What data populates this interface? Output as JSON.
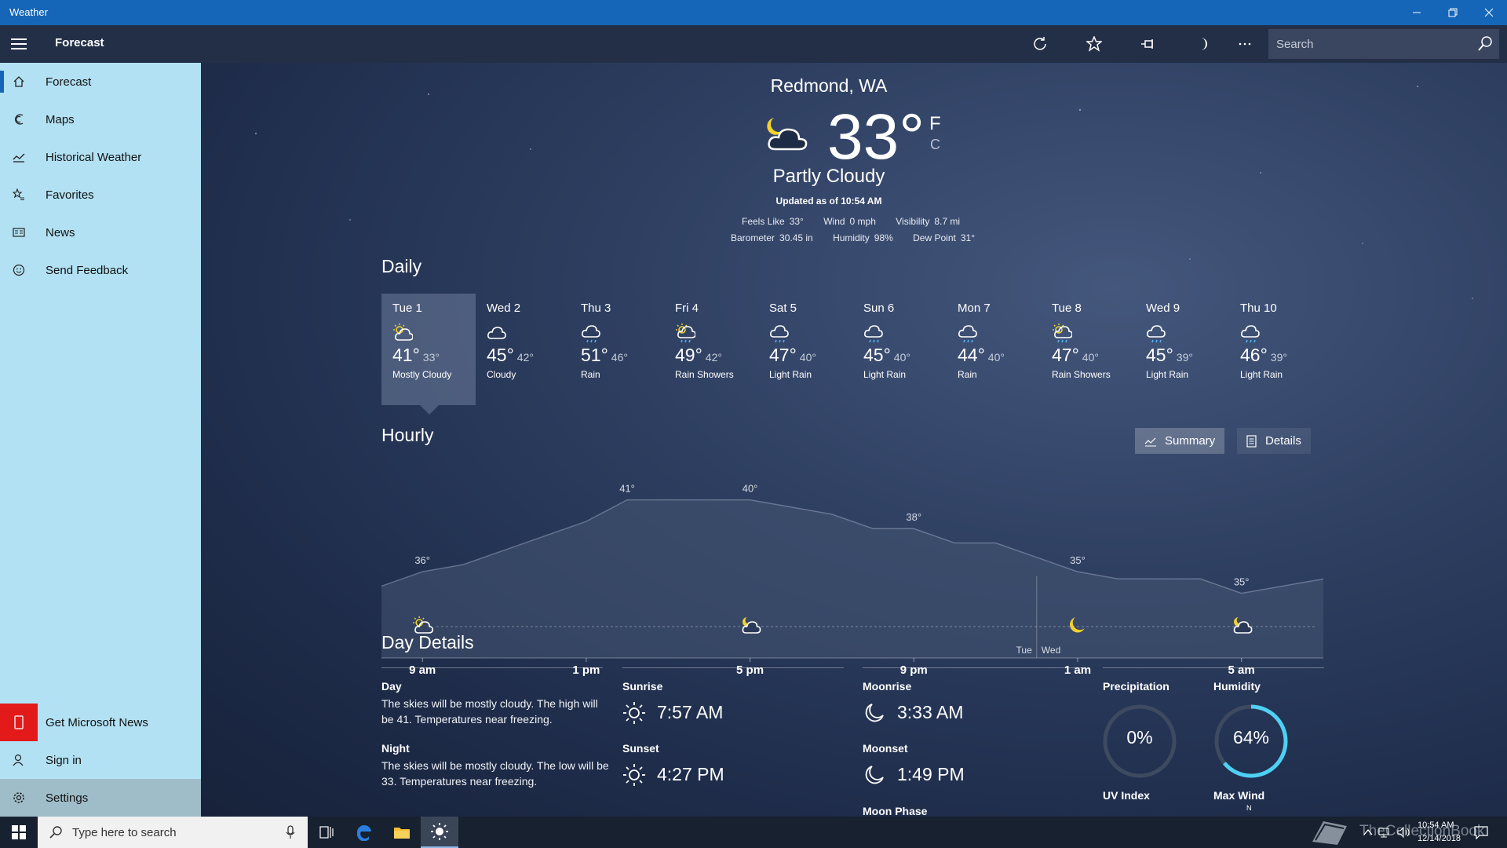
{
  "window": {
    "title": "Weather"
  },
  "header": {
    "title": "Forecast",
    "search_placeholder": "Search"
  },
  "nav": {
    "items": [
      {
        "label": "Forecast",
        "icon": "home-icon"
      },
      {
        "label": "Maps",
        "icon": "map-icon"
      },
      {
        "label": "Historical Weather",
        "icon": "chart-icon"
      },
      {
        "label": "Favorites",
        "icon": "favorites-icon"
      },
      {
        "label": "News",
        "icon": "news-icon"
      },
      {
        "label": "Send Feedback",
        "icon": "smiley-icon"
      }
    ],
    "bottom": [
      {
        "label": "Get Microsoft News",
        "icon": "phone-icon"
      },
      {
        "label": "Sign in",
        "icon": "person-icon"
      },
      {
        "label": "Settings",
        "icon": "gear-icon"
      }
    ]
  },
  "current": {
    "location": "Redmond, WA",
    "temp": "33°",
    "unit_f": "F",
    "unit_c": "C",
    "condition": "Partly Cloudy",
    "updated": "Updated as of 10:54 AM",
    "feels_like_label": "Feels Like",
    "feels_like": "33°",
    "wind_label": "Wind",
    "wind": "0 mph",
    "visibility_label": "Visibility",
    "visibility": "8.7 mi",
    "barometer_label": "Barometer",
    "barometer": "30.45 in",
    "humidity_label": "Humidity",
    "humidity": "98%",
    "dew_point_label": "Dew Point",
    "dew_point": "31°"
  },
  "daily": {
    "title": "Daily",
    "days": [
      {
        "name": "Tue 1",
        "hi": "41°",
        "lo": "33°",
        "cond": "Mostly Cloudy",
        "icon": "mostly-cloudy"
      },
      {
        "name": "Wed 2",
        "hi": "45°",
        "lo": "42°",
        "cond": "Cloudy",
        "icon": "cloudy"
      },
      {
        "name": "Thu 3",
        "hi": "51°",
        "lo": "46°",
        "cond": "Rain",
        "icon": "rain"
      },
      {
        "name": "Fri 4",
        "hi": "49°",
        "lo": "42°",
        "cond": "Rain Showers",
        "icon": "rain-showers"
      },
      {
        "name": "Sat 5",
        "hi": "47°",
        "lo": "40°",
        "cond": "Light Rain",
        "icon": "rain"
      },
      {
        "name": "Sun 6",
        "hi": "45°",
        "lo": "40°",
        "cond": "Light Rain",
        "icon": "rain"
      },
      {
        "name": "Mon 7",
        "hi": "44°",
        "lo": "40°",
        "cond": "Rain",
        "icon": "rain"
      },
      {
        "name": "Tue 8",
        "hi": "47°",
        "lo": "40°",
        "cond": "Rain Showers",
        "icon": "rain-showers"
      },
      {
        "name": "Wed 9",
        "hi": "45°",
        "lo": "39°",
        "cond": "Light Rain",
        "icon": "rain"
      },
      {
        "name": "Thu 10",
        "hi": "46°",
        "lo": "39°",
        "cond": "Light Rain",
        "icon": "rain"
      }
    ]
  },
  "hourly": {
    "title": "Hourly",
    "summary_label": "Summary",
    "details_label": "Details",
    "day_divider": {
      "before": "Tue",
      "after": "Wed"
    },
    "time_labels": [
      "9 am",
      "1 pm",
      "5 pm",
      "9 pm",
      "1 am",
      "5 am"
    ],
    "temp_labels": [
      {
        "hour": 9,
        "text": "36°"
      },
      {
        "hour": 14,
        "text": "41°"
      },
      {
        "hour": 17,
        "text": "40°"
      },
      {
        "hour": 21,
        "text": "38°"
      },
      {
        "hour": 25,
        "text": "35°"
      },
      {
        "hour": 29,
        "text": "35°"
      }
    ],
    "icons": [
      {
        "hour": 9,
        "icon": "mostly-cloudy"
      },
      {
        "hour": 17,
        "icon": "partly-cloudy-night"
      },
      {
        "hour": 25,
        "icon": "moon"
      },
      {
        "hour": 29,
        "icon": "partly-cloudy-night"
      }
    ]
  },
  "chart_data": {
    "type": "area",
    "x": [
      8,
      9,
      10,
      11,
      12,
      13,
      14,
      15,
      16,
      17,
      18,
      19,
      20,
      21,
      22,
      23,
      24,
      25,
      26,
      27,
      28,
      29,
      30,
      31
    ],
    "series": [
      {
        "values": [
          35,
          36,
          36.5,
          37.5,
          38.5,
          39.5,
          41,
          41,
          41,
          41,
          40.5,
          40,
          39,
          39,
          38,
          38,
          37,
          36,
          35.5,
          35.5,
          35.5,
          34.5,
          35,
          35.5
        ]
      }
    ],
    "ylim": [
      30,
      43
    ]
  },
  "day_details": {
    "title": "Day Details",
    "day_label": "Day",
    "day_text": "The skies will be mostly cloudy. The high will be 41. Temperatures near freezing.",
    "night_label": "Night",
    "night_text": "The skies will be mostly cloudy. The low will be 33. Temperatures near freezing.",
    "sunrise_label": "Sunrise",
    "sunrise": "7:57 AM",
    "sunset_label": "Sunset",
    "sunset": "4:27 PM",
    "moonrise_label": "Moonrise",
    "moonrise": "3:33 AM",
    "moonset_label": "Moonset",
    "moonset": "1:49 PM",
    "moon_phase_label": "Moon Phase",
    "precip_label": "Precipitation",
    "precip": "0%",
    "precip_value": 0,
    "humidity_label": "Humidity",
    "humidity": "64%",
    "humidity_value": 0.64,
    "uv_label": "UV Index",
    "max_wind_label": "Max Wind",
    "compass_n": "N"
  },
  "taskbar": {
    "search_placeholder": "Type here to search",
    "time": "10:54 AM",
    "date": "12/14/2018",
    "watermark": "TheCollectionBook"
  },
  "colors": {
    "accent": "#1565b8",
    "sidebar": "#b2e1f3",
    "header": "#232f46",
    "humidity_ring": "#4fd0f5"
  }
}
